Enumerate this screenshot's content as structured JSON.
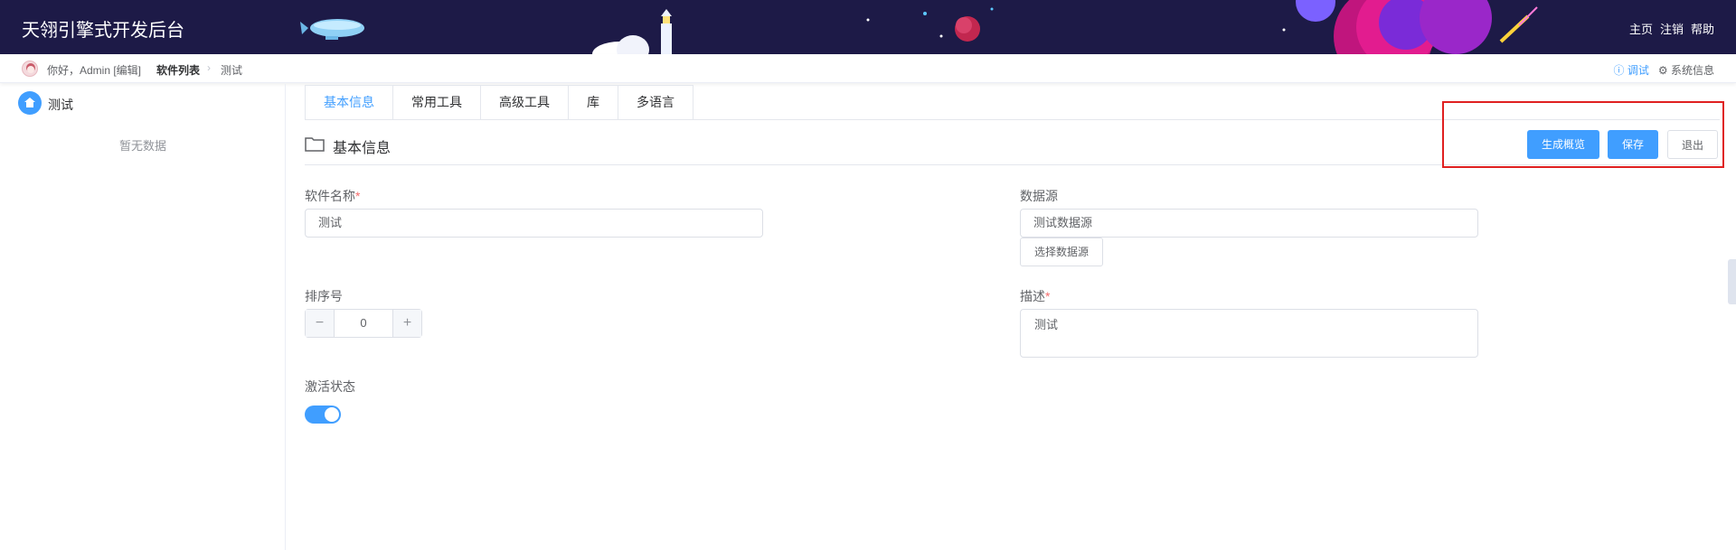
{
  "header": {
    "title": "天翎引擎式开发后台",
    "links": [
      "主页",
      "注销",
      "帮助"
    ]
  },
  "breadcrumb": {
    "greeting": "你好，Admin [编辑]",
    "list": "软件列表",
    "current": "测试",
    "debug": "调试",
    "system_info": "系统信息"
  },
  "sidebar": {
    "item": "测试",
    "empty": "暂无数据"
  },
  "tabs": [
    "基本信息",
    "常用工具",
    "高级工具",
    "库",
    "多语言"
  ],
  "section": {
    "title": "基本信息"
  },
  "buttons": {
    "generate": "生成概览",
    "save": "保存",
    "exit": "退出"
  },
  "form": {
    "name_label": "软件名称",
    "name_value": "测试",
    "datasource_label": "数据源",
    "datasource_value": "测试数据源",
    "select_datasource": "选择数据源",
    "order_label": "排序号",
    "order_value": "0",
    "desc_label": "描述",
    "desc_value": "测试",
    "active_label": "激活状态",
    "active": true
  },
  "colors": {
    "header_bg": "#1d1a47",
    "primary": "#409eff",
    "highlight": "#e02020"
  }
}
